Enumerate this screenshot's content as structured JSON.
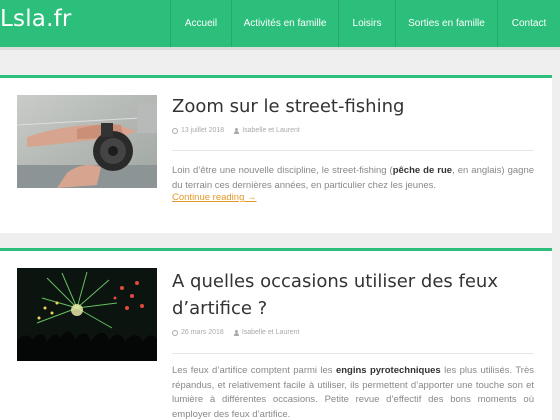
{
  "site": {
    "logo": "Lsla.fr"
  },
  "nav": {
    "items": [
      {
        "label": "Accueil"
      },
      {
        "label": "Activités en famille"
      },
      {
        "label": "Loisirs"
      },
      {
        "label": "Sorties en famille"
      },
      {
        "label": "Contact"
      }
    ]
  },
  "articles": [
    {
      "title": "Zoom sur le street-fishing",
      "date": "13 juillet 2018",
      "author": "Isabelle et Laurent",
      "excerpt_pre": "Loin d’être une nouvelle discipline, le street-fishing (",
      "excerpt_bold": "pêche de rue",
      "excerpt_post": ", en anglais) gagne du terrain ces dernières années, en particulier chez les jeunes.",
      "more": "Continue reading →",
      "thumb_icon": "fishing-reel-photo"
    },
    {
      "title": "A quelles occasions utiliser des feux d’artifice ?",
      "date": "26 mars 2018",
      "author": "Isabelle et Laurent",
      "excerpt_pre": "Les feux d’artifice comptent parmi les ",
      "excerpt_bold": "engins pyrotechniques",
      "excerpt_post": " les plus utilisés. Très répandus, et relativement facile à utiliser, ils permettent d’apporter une touche son et lumière à différentes occasions. Petite revue d’effectif des bons moments où employer des feux d’artifice.",
      "thumb_icon": "fireworks-photo"
    }
  ],
  "colors": {
    "accent": "#2bbf7b",
    "link": "#e39a2a"
  }
}
